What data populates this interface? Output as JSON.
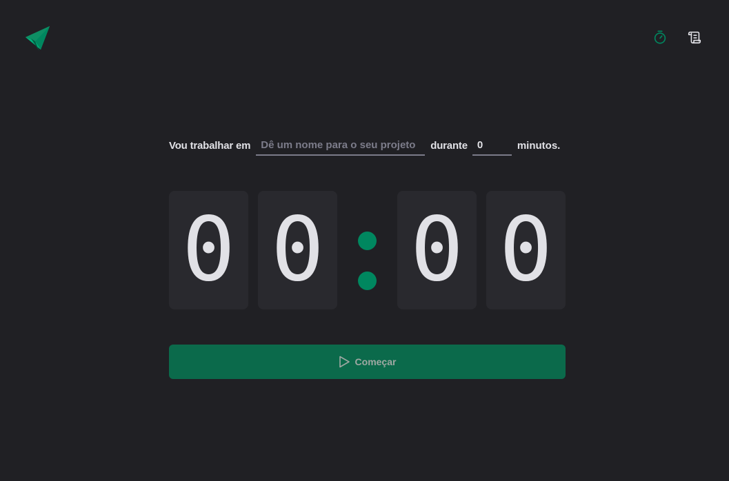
{
  "header": {
    "logo_icon": "ignite-timer-logo-icon",
    "nav": [
      {
        "icon": "timer-icon",
        "active": true,
        "color": "#00875F"
      },
      {
        "icon": "history-scroll-icon",
        "active": false,
        "color": "#E1E1E6"
      }
    ]
  },
  "form": {
    "task_label": "Vou trabalhar em",
    "task_placeholder": "Dê um nome para o seu projeto",
    "task_value": "",
    "duration_label": "durante",
    "minutes_value": "0",
    "minutes_suffix": "minutos."
  },
  "countdown": {
    "minutes": [
      "0",
      "0"
    ],
    "separator": ":",
    "seconds": [
      "0",
      "0"
    ]
  },
  "start_button": {
    "label": "Começar",
    "icon": "play-icon",
    "disabled": true
  },
  "colors": {
    "background": "#202024",
    "card": "#29292E",
    "accent": "#00875F",
    "button": "#0B6A4B",
    "text": "#E1E1E6",
    "placeholder": "#7C7C8A"
  }
}
